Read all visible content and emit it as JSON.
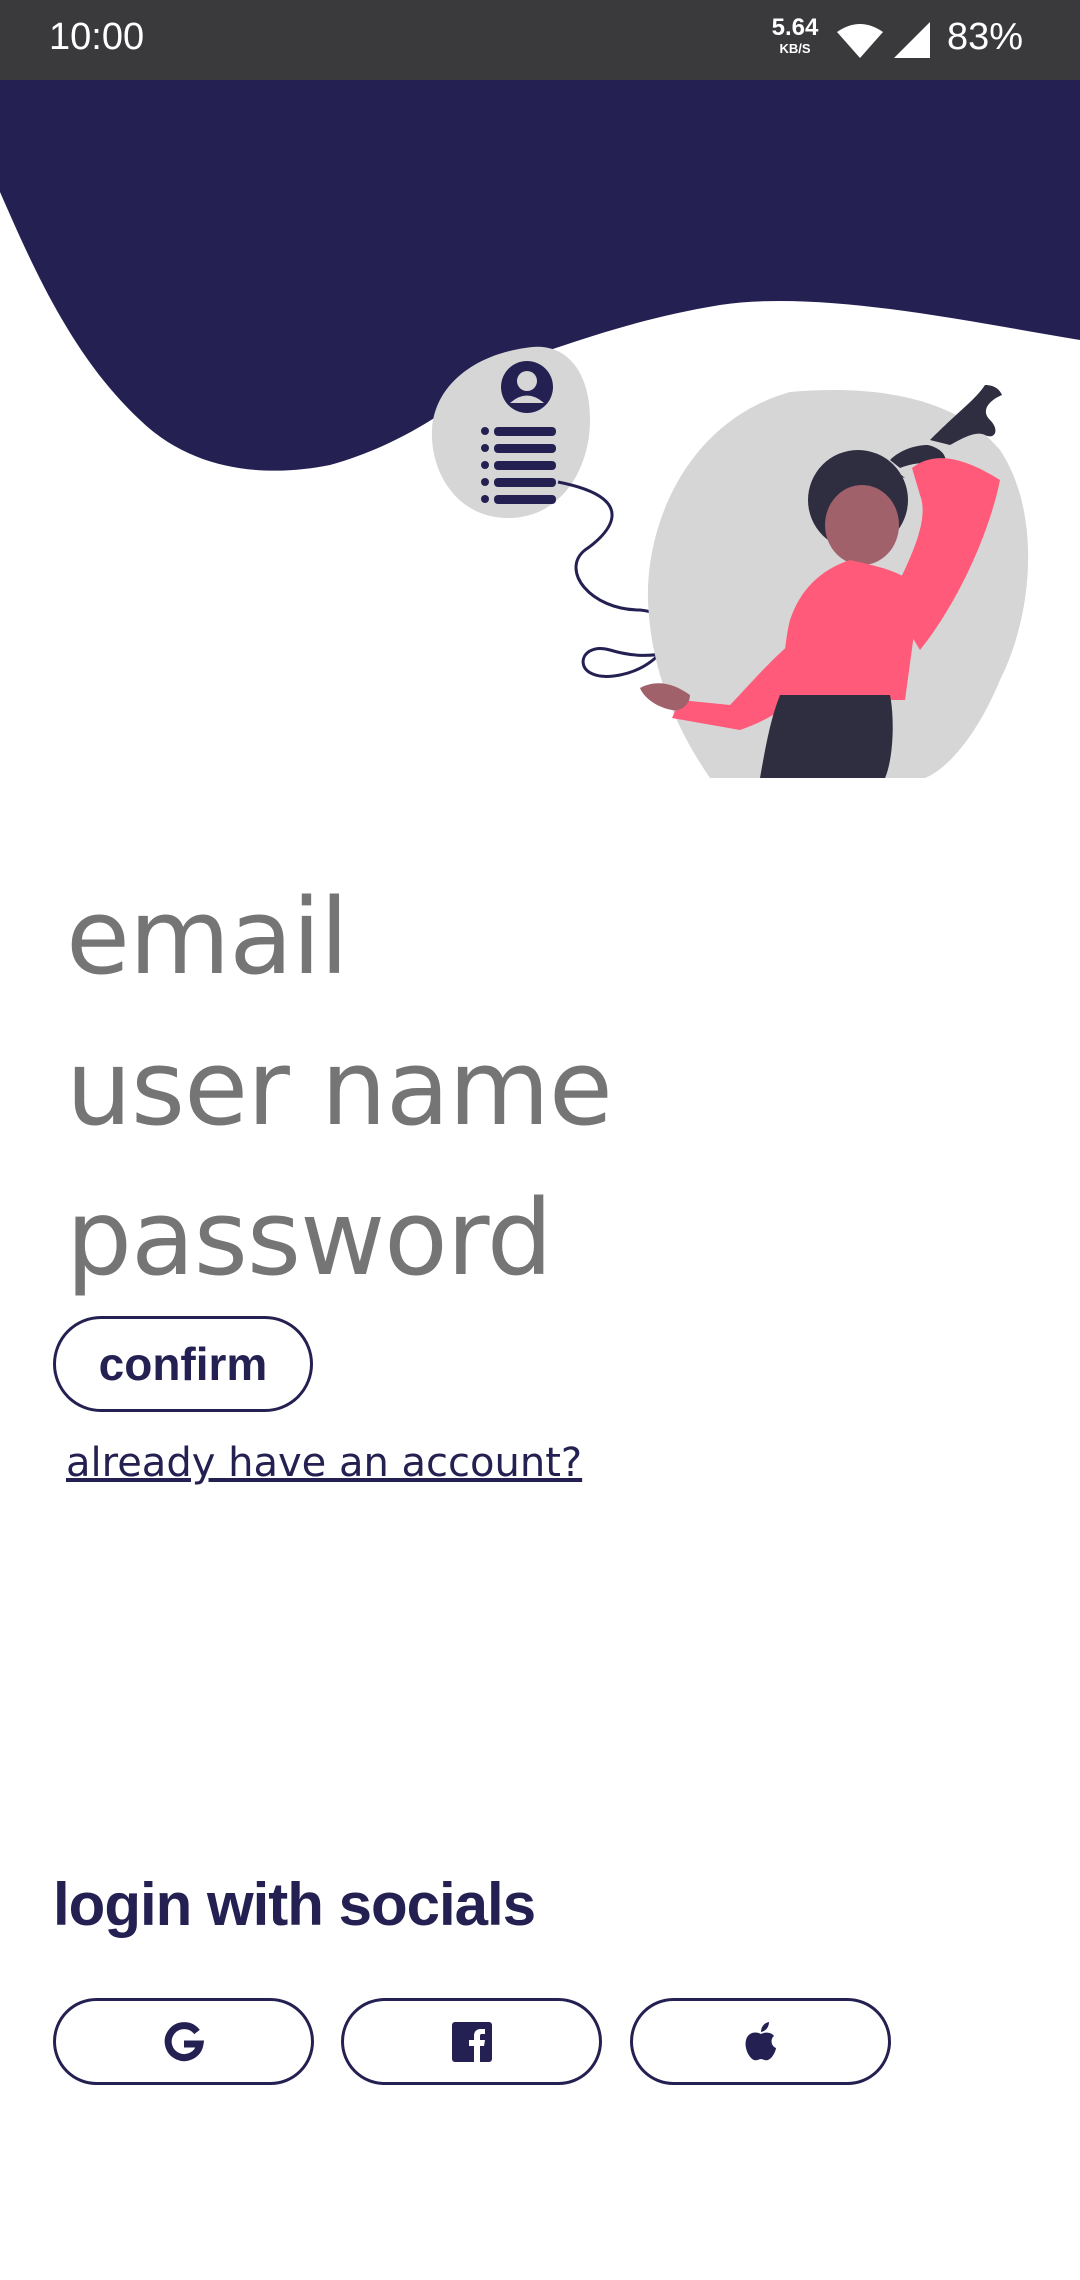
{
  "status_bar": {
    "time": "10:00",
    "net_speed_value": "5.64",
    "net_speed_unit": "KB/S",
    "battery": "83%",
    "icons": [
      "wifi-icon",
      "signal-icon"
    ]
  },
  "colors": {
    "navy": "#242152",
    "pink": "#ff5a79",
    "field_text": "#757575",
    "blob_gray": "#d6d6d6"
  },
  "form": {
    "email_placeholder": "email",
    "username_placeholder": "user name",
    "password_placeholder": "password",
    "confirm_label": "confirm",
    "login_link": "already have an account?"
  },
  "socials": {
    "heading": "login with socials",
    "buttons": [
      {
        "icon": "google-icon"
      },
      {
        "icon": "facebook-icon"
      },
      {
        "icon": "apple-icon"
      }
    ]
  }
}
